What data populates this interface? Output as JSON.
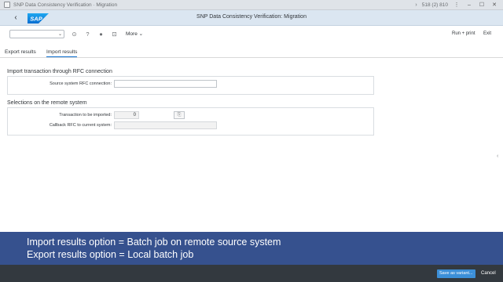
{
  "window": {
    "title": "SNP Data Consistency Verification · Migration",
    "nav_arrows": "›",
    "session": "518 (2) 810",
    "controls": [
      "⋮",
      "–",
      "☐",
      "✕"
    ]
  },
  "shell": {
    "back_label": "‹",
    "logo_text": "SAP",
    "title": "SNP Data Consistency Verification: Migration",
    "brand_color": "#0a6ed1"
  },
  "toolbar": {
    "command_value": "",
    "dropdown": "⌄",
    "icons": [
      "⊙",
      "?",
      "●",
      "⊡"
    ],
    "more": "More",
    "more_caret": "⌄",
    "run_print": "Run + print",
    "exit": "Exit"
  },
  "tabs": [
    {
      "label": "Export results"
    },
    {
      "label": "Import results"
    }
  ],
  "import_group": {
    "title": "Import transaction through RFC connection",
    "source_label": "Source system RFC connection:",
    "source_value": ""
  },
  "remote_group": {
    "title": "Selections on the remote system",
    "transaction_label": "Transaction to be imported:",
    "transaction_value": "0",
    "copy_icon": "⎘",
    "callback_label": "Callback RFC to current system:",
    "callback_value": ""
  },
  "scroll_handle": "‹",
  "caption": {
    "line1": "Import results option = Batch job on remote source system",
    "line2": "Export results option = Local batch job"
  },
  "footer": {
    "save_variant": "Save as variant...",
    "cancel": "Cancel"
  }
}
